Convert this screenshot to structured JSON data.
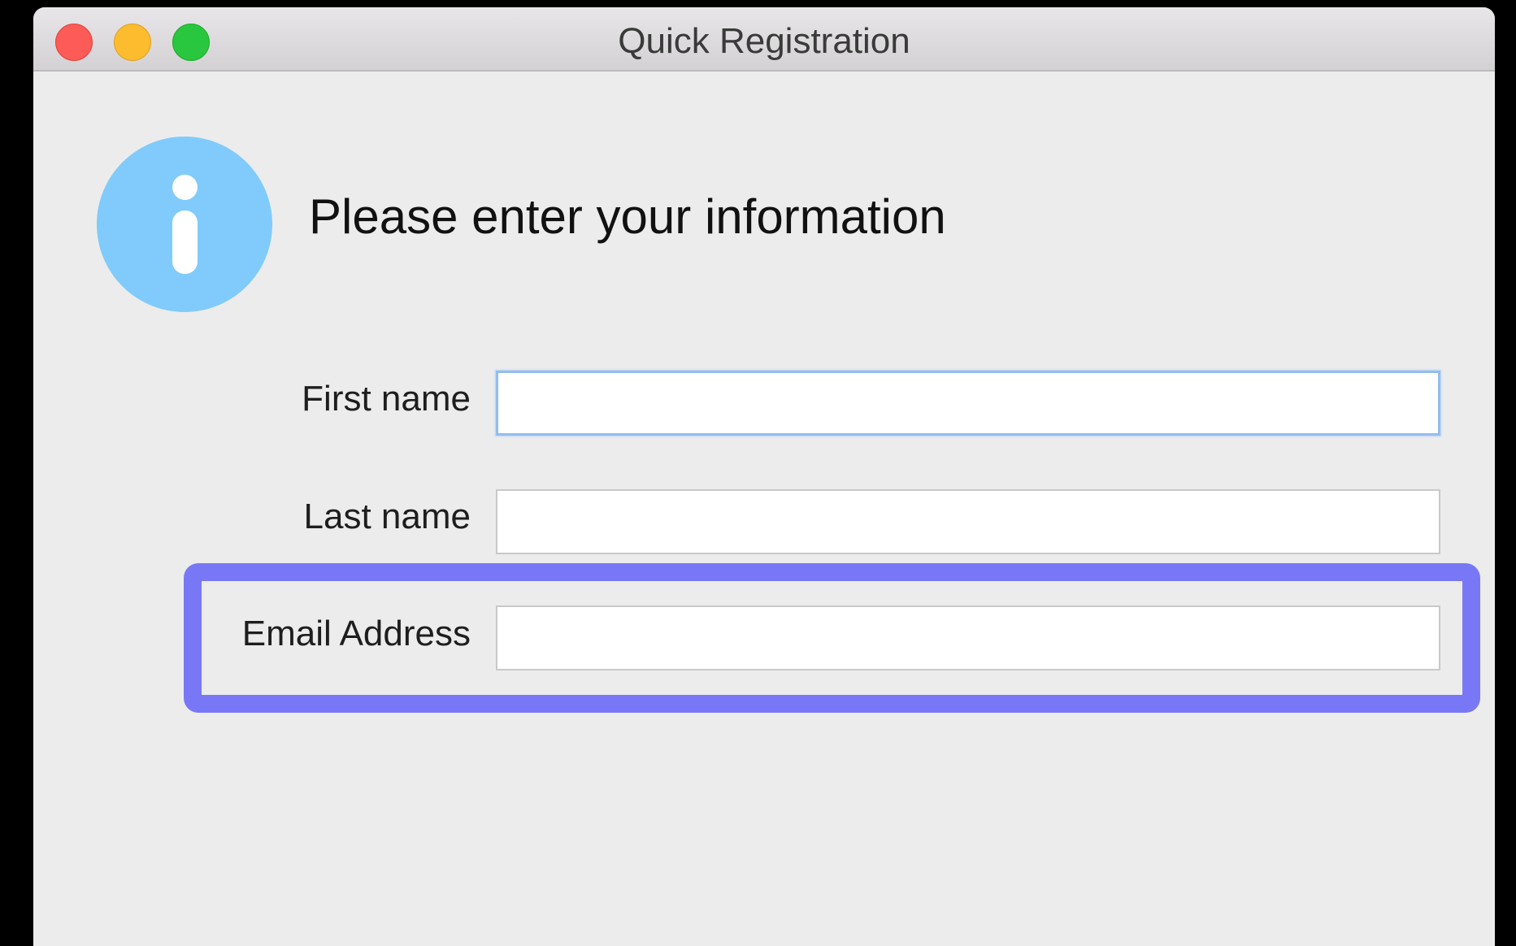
{
  "window": {
    "title": "Quick Registration"
  },
  "header": {
    "icon": "info-icon",
    "text": "Please enter your information"
  },
  "form": {
    "first_name": {
      "label": "First name",
      "value": ""
    },
    "last_name": {
      "label": "Last name",
      "value": ""
    },
    "email": {
      "label": "Email Address",
      "value": ""
    }
  },
  "colors": {
    "info_icon": "#80cbfb",
    "highlight_annotation": "#7878f6",
    "focus_ring": "#93bdf0"
  }
}
